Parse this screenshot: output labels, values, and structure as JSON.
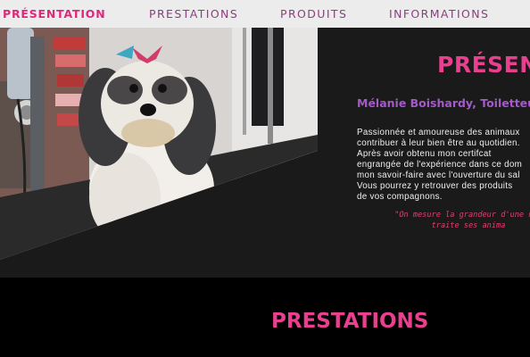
{
  "nav": {
    "items": [
      {
        "label": "PRÉSENTATION",
        "active": true
      },
      {
        "label": "PRESTATIONS",
        "active": false
      },
      {
        "label": "PRODUITS",
        "active": false
      },
      {
        "label": "INFORMATIONS",
        "active": false
      }
    ]
  },
  "hero": {
    "title": "PRÉSENT",
    "subtitle": "Mélanie Boishardy, Toiletteuse",
    "paragraph_lines": [
      "Passionnée et amoureuse des animaux",
      "contribuer à leur bien être au quotidien.",
      "Après avoir obtenu mon certifcat",
      "engrangée de l'expérience dans ce dom",
      "mon savoir-faire avec l'ouverture du sal",
      "Vous pourrez y retrouver des produits",
      "de vos compagnons."
    ],
    "quote_lines": [
      "\"On mesure la grandeur d'une nat",
      "traite ses anima"
    ]
  },
  "section2": {
    "title": "PRESTATIONS"
  },
  "colors": {
    "accent_pink": "#e83f8f",
    "nav_purple": "#8a3f7e",
    "subtitle_purple": "#a45ac7",
    "quote_pink": "#e0406e",
    "hero_bg": "#1b1a1b"
  }
}
